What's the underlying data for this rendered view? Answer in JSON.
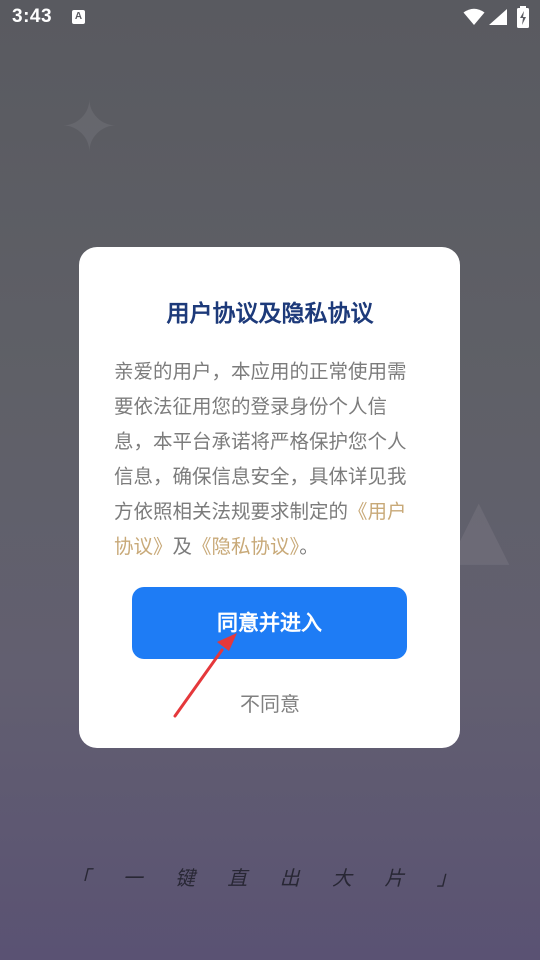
{
  "status_bar": {
    "time": "3:43",
    "notification_letter": "A"
  },
  "dialog": {
    "title": "用户协议及隐私协议",
    "body_intro": "亲爱的用户，本应用的正常使用需要依法征用您的登录身份个人信息，本平台承诺将严格保护您个人信息，确保信息安全，具体详见我方依照相关法规要求制定的",
    "user_agreement_link": "《用户协议》",
    "conjunction": "及",
    "privacy_agreement_link": "《隐私协议》",
    "ending": "。",
    "agree_label": "同意并进入",
    "disagree_label": "不同意"
  },
  "slogan": "「 一 键 直 出 大 片 」",
  "colors": {
    "title": "#1d3a7a",
    "link": "#c8a978",
    "primary_button": "#1e7cf5",
    "annotation_arrow": "#e5383b"
  }
}
